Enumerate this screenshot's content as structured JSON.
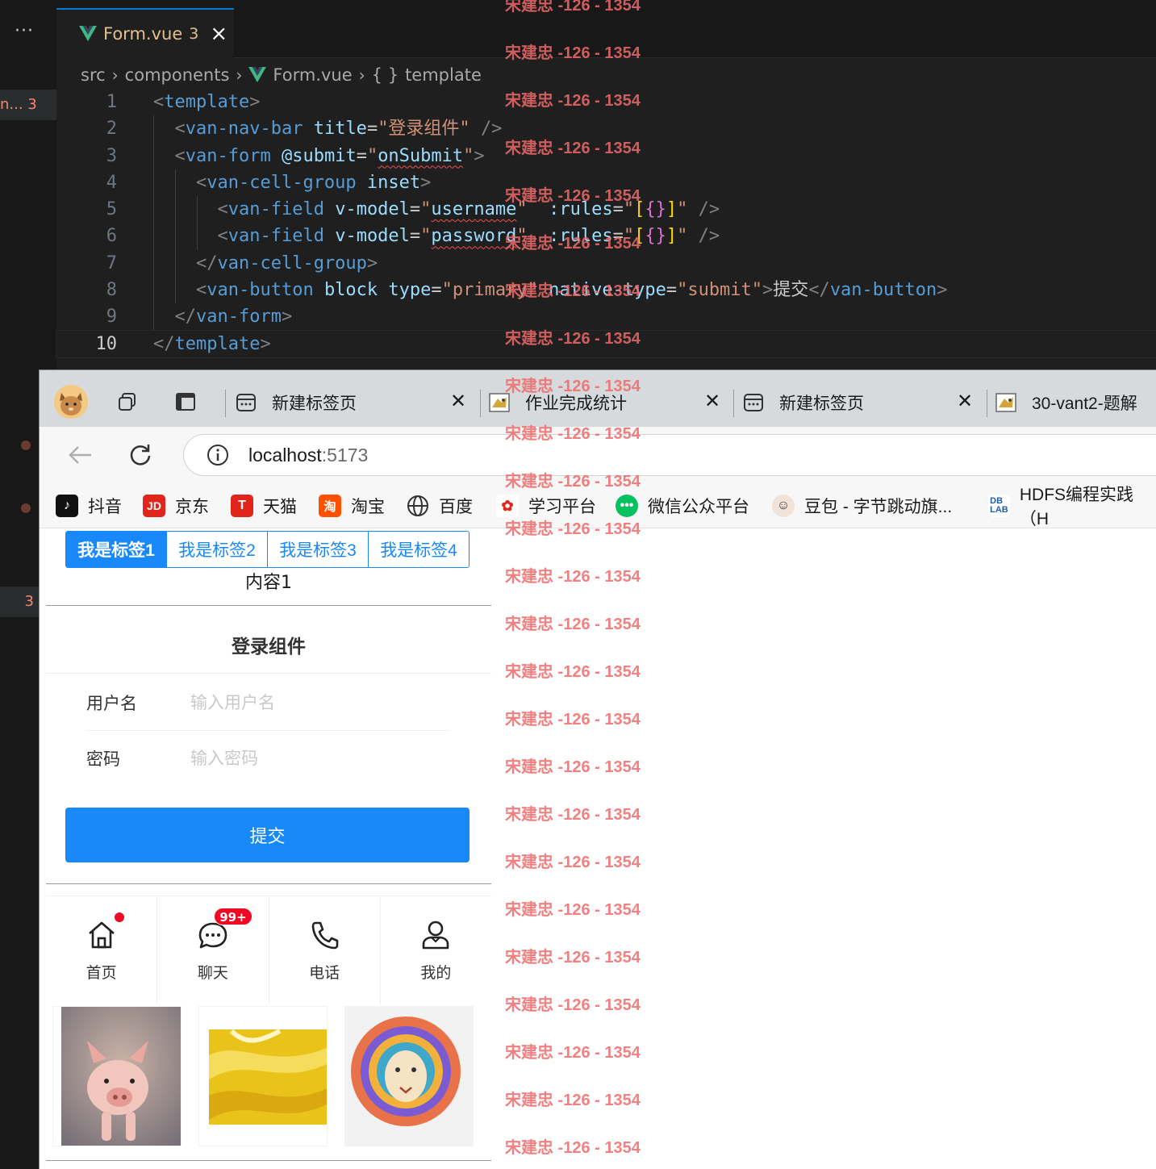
{
  "editor": {
    "more_label": "···",
    "side_badges": [
      "n... 3",
      "3"
    ],
    "tab": {
      "name": "Form.vue",
      "problems": "3",
      "close": "×"
    },
    "breadcrumbs": [
      "src",
      "components",
      "Form.vue",
      "{ }",
      "template"
    ],
    "line_numbers": [
      "1",
      "2",
      "3",
      "4",
      "5",
      "6",
      "7",
      "8",
      "9",
      "10"
    ],
    "colors": {
      "tag": "#569cd6",
      "attr": "#9cdcfe",
      "string": "#ce9178",
      "accent": "#0078d4"
    }
  },
  "browser": {
    "tabs": [
      {
        "title": "新建标签页"
      },
      {
        "title": "作业完成统计"
      },
      {
        "title": "新建标签页"
      },
      {
        "title": "30-vant2-题解"
      }
    ],
    "address": {
      "host": "localhost",
      "port": ":5173"
    },
    "bookmarks": [
      "抖音",
      "京东",
      "天猫",
      "淘宝",
      "百度",
      "学习平台",
      "微信公众平台",
      "豆包 - 字节跳动旗...",
      "HDFS编程实践（H"
    ]
  },
  "app": {
    "segments": [
      "我是标签1",
      "我是标签2",
      "我是标签3",
      "我是标签4"
    ],
    "active_segment": 0,
    "segment_content": "内容1",
    "nav_title": "登录组件",
    "fields": [
      {
        "label": "用户名",
        "placeholder": "输入用户名"
      },
      {
        "label": "密码",
        "placeholder": "输入密码"
      }
    ],
    "submit_label": "提交",
    "tabbar": [
      {
        "label": "首页",
        "icon": "home-icon",
        "dot": true
      },
      {
        "label": "聊天",
        "icon": "chat-icon",
        "badge": "99+"
      },
      {
        "label": "电话",
        "icon": "phone-icon"
      },
      {
        "label": "我的",
        "icon": "user-icon"
      }
    ],
    "primary_color": "#1989fa",
    "badge_color": "#ee0a24"
  },
  "watermark": "宋建忠 -126 - 1354"
}
